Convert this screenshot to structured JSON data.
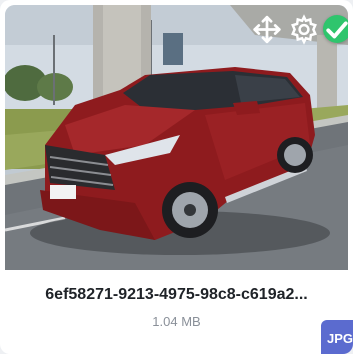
{
  "file": {
    "name": "6ef58271-9213-4975-98c8-c619a2...",
    "size": "1.04 MB",
    "type_badge": "JPG"
  },
  "preview": {
    "description_icons": [
      "move-icon",
      "gear-icon",
      "check-icon"
    ],
    "plate_text": "",
    "colors": {
      "sky": "#cdd6de",
      "car_body": "#8e1b1e",
      "road": "#6f7479",
      "grass": "#8a9a4c",
      "check_bg": "#2fc56d",
      "badge_bg": "#5b6bcf"
    }
  },
  "actions": {
    "move_label": "",
    "settings_label": "",
    "confirm_label": ""
  }
}
